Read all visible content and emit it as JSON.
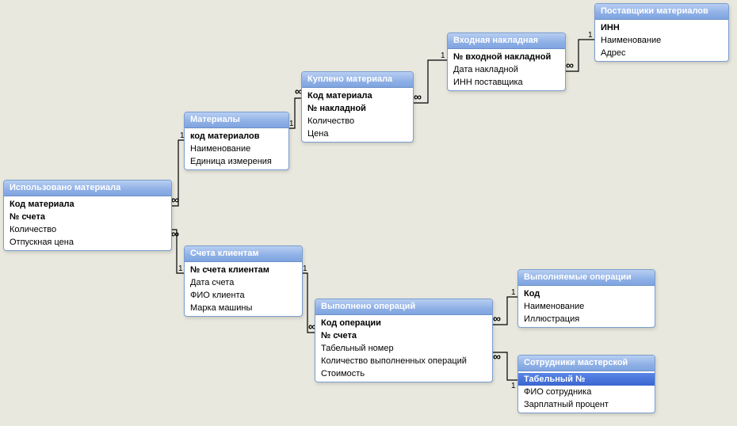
{
  "tables": {
    "used_material": {
      "title": "Использовано материала",
      "fields": [
        {
          "label": "Код материала",
          "pk": true
        },
        {
          "label": "№ счета",
          "pk": true
        },
        {
          "label": "Количество"
        },
        {
          "label": "Отпускная цена"
        }
      ]
    },
    "materials": {
      "title": "Материалы",
      "fields": [
        {
          "label": "код материалов",
          "pk": true
        },
        {
          "label": "Наименование"
        },
        {
          "label": "Единица измерения"
        }
      ]
    },
    "bought_material": {
      "title": "Куплено материала",
      "fields": [
        {
          "label": "Код материала",
          "pk": true
        },
        {
          "label": "№ накладной",
          "pk": true
        },
        {
          "label": "Количество"
        },
        {
          "label": "Цена"
        }
      ]
    },
    "in_invoice": {
      "title": "Входная накладная",
      "fields": [
        {
          "label": "№ входной накладной",
          "pk": true
        },
        {
          "label": "Дата накладной"
        },
        {
          "label": "ИНН поставщика"
        }
      ]
    },
    "suppliers": {
      "title": "Поставщики материалов",
      "fields": [
        {
          "label": "ИНН",
          "pk": true
        },
        {
          "label": "Наименование"
        },
        {
          "label": "Адрес"
        }
      ]
    },
    "client_bills": {
      "title": "Счета клиентам",
      "fields": [
        {
          "label": "№ счета клиентам",
          "pk": true
        },
        {
          "label": "Дата счета"
        },
        {
          "label": "ФИО клиента"
        },
        {
          "label": "Марка машины"
        }
      ]
    },
    "done_ops": {
      "title": "Выполнено операций",
      "fields": [
        {
          "label": "Код операции",
          "pk": true
        },
        {
          "label": "№ счета",
          "pk": true
        },
        {
          "label": "Табельный номер"
        },
        {
          "label": "Количество выполненных операций"
        },
        {
          "label": "Стоимость"
        }
      ]
    },
    "ops_exec": {
      "title": "Выполняемые операции",
      "fields": [
        {
          "label": "Код",
          "pk": true
        },
        {
          "label": "Наименование"
        },
        {
          "label": "Иллюстрация"
        }
      ]
    },
    "staff": {
      "title": "Сотрудники мастерской",
      "fields": [
        {
          "label": "Табельный №",
          "pk": true,
          "selected": true
        },
        {
          "label": "ФИО сотрудника"
        },
        {
          "label": "Зарплатный процент"
        }
      ]
    }
  },
  "relationships": [
    {
      "from": "materials",
      "to": "used_material",
      "card_from": "1",
      "card_to": "∞"
    },
    {
      "from": "materials",
      "to": "bought_material",
      "card_from": "1",
      "card_to": "∞"
    },
    {
      "from": "in_invoice",
      "to": "bought_material",
      "card_from": "1",
      "card_to": "∞"
    },
    {
      "from": "suppliers",
      "to": "in_invoice",
      "card_from": "1",
      "card_to": "∞"
    },
    {
      "from": "client_bills",
      "to": "used_material",
      "card_from": "1",
      "card_to": "∞"
    },
    {
      "from": "client_bills",
      "to": "done_ops",
      "card_from": "1",
      "card_to": "∞"
    },
    {
      "from": "ops_exec",
      "to": "done_ops",
      "card_from": "1",
      "card_to": "∞"
    },
    {
      "from": "staff",
      "to": "done_ops",
      "card_from": "1",
      "card_to": "∞"
    }
  ]
}
